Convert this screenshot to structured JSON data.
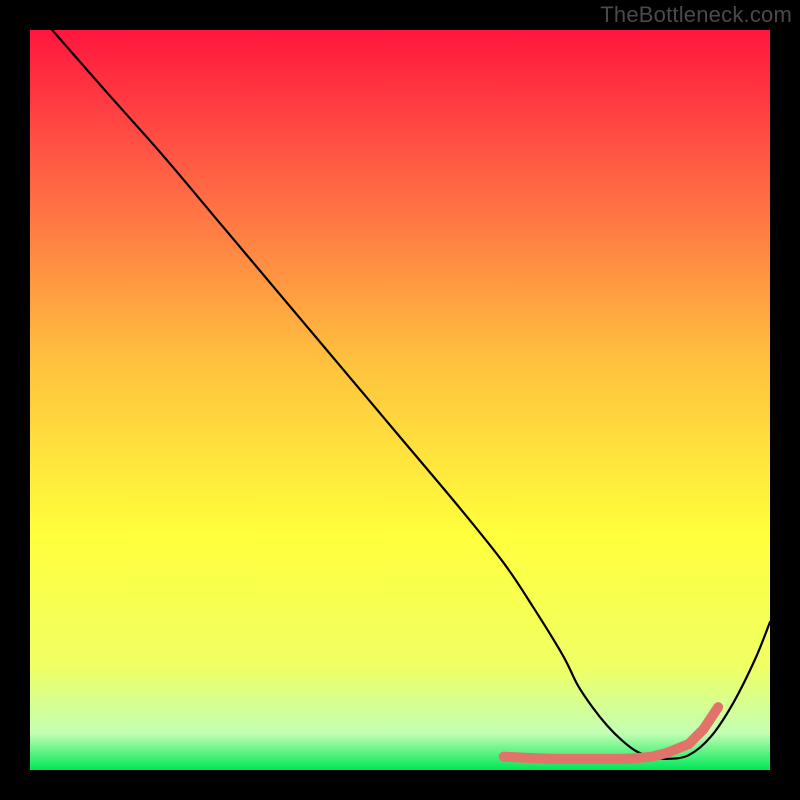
{
  "watermark": "TheBottleneck.com",
  "colors": {
    "frame": "#000000",
    "curve": "#000000",
    "marker": "#e2736b",
    "grad_top": "#ff163e",
    "grad_mid1": "#ff6a45",
    "grad_mid2": "#ffc23e",
    "grad_mid3": "#ffff3c",
    "grad_mid4": "#f0ff64",
    "grad_bot_light": "#c3ffb3",
    "grad_bot": "#00e756"
  },
  "chart_data": {
    "type": "line",
    "title": "",
    "xlabel": "",
    "ylabel": "",
    "xlim": [
      0,
      100
    ],
    "ylim": [
      0,
      100
    ],
    "x": [
      3,
      10,
      18,
      26,
      34,
      42,
      50,
      58,
      64,
      68,
      72,
      74,
      76,
      78,
      80,
      82,
      84,
      86,
      89,
      92,
      95,
      98,
      100
    ],
    "values": [
      100,
      92,
      83,
      73.5,
      64,
      54.5,
      45,
      35.5,
      28,
      22,
      15.5,
      11.5,
      8.5,
      6,
      4,
      2.5,
      1.8,
      1.5,
      2,
      4.5,
      9,
      15,
      20
    ],
    "marker_points": {
      "x": [
        64,
        68,
        71,
        74,
        76,
        78,
        80,
        82,
        84,
        86,
        89,
        91,
        93
      ],
      "values": [
        1.8,
        1.6,
        1.5,
        1.5,
        1.5,
        1.5,
        1.5,
        1.6,
        1.8,
        2.3,
        3.5,
        5.5,
        8.5
      ]
    }
  }
}
